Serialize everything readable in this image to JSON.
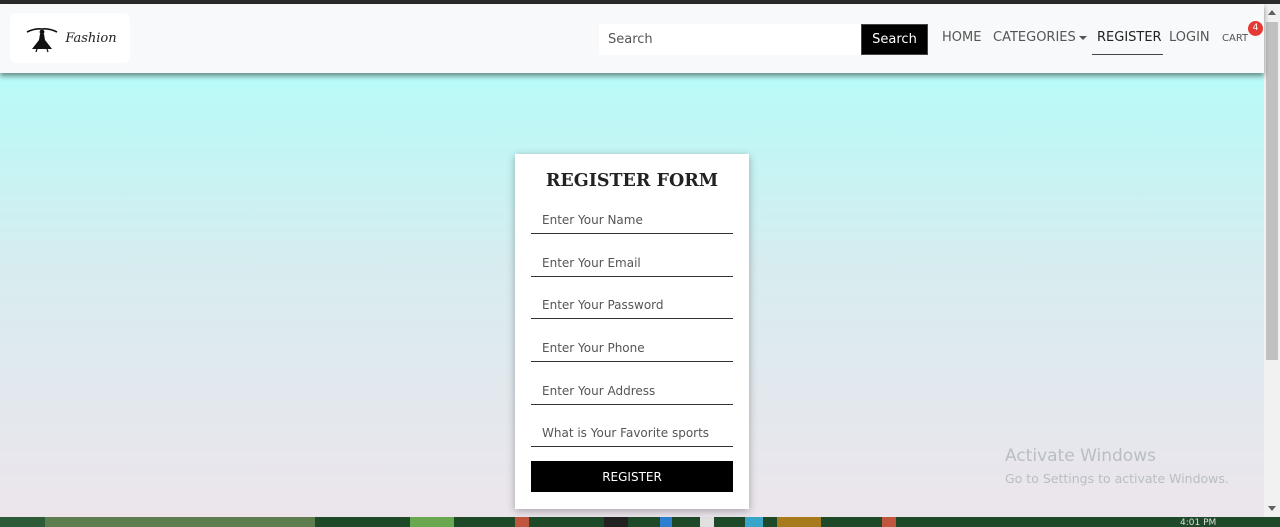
{
  "brand": {
    "logo_text": "Fashion"
  },
  "search": {
    "placeholder": "Search",
    "button_label": "Search"
  },
  "nav": {
    "home": "HOME",
    "categories": "CATEGORIES",
    "register": "REGISTER",
    "login": "LOGIN",
    "cart": "CART",
    "cart_count": "4"
  },
  "form": {
    "title": "REGISTER FORM",
    "fields": [
      {
        "placeholder": "Enter Your Name"
      },
      {
        "placeholder": "Enter Your Email"
      },
      {
        "placeholder": "Enter Your Password"
      },
      {
        "placeholder": "Enter Your Phone"
      },
      {
        "placeholder": "Enter Your Address"
      },
      {
        "placeholder": "What is Your Favorite sports"
      }
    ],
    "submit_label": "REGISTER"
  },
  "watermark": {
    "title": "Activate Windows",
    "subtitle": "Go to Settings to activate Windows."
  },
  "taskbar": {
    "clock": "4:01 PM"
  },
  "colors": {
    "gradient_top": "#b7fbf8",
    "gradient_bottom": "#ece5ec",
    "badge": "#e53935",
    "button": "#000000"
  }
}
